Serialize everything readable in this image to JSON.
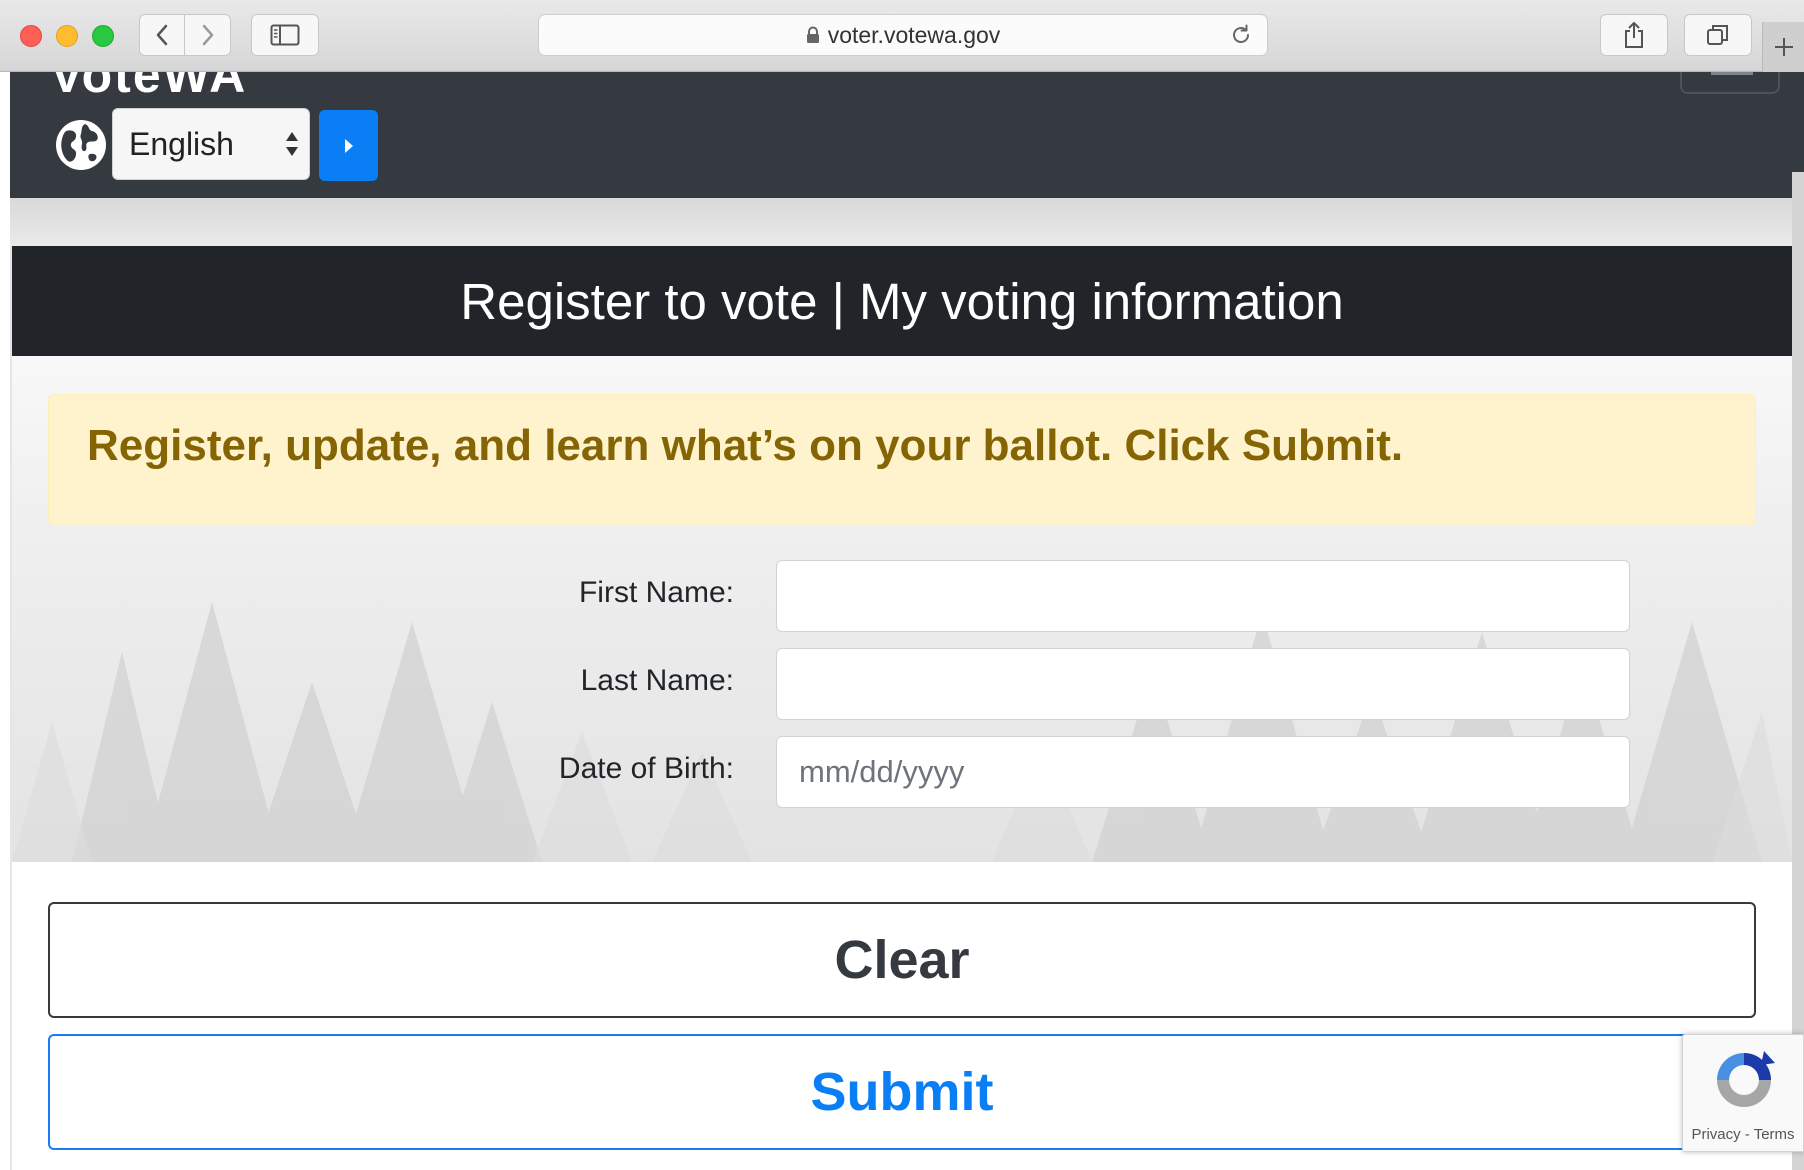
{
  "browser": {
    "url": "voter.votewa.gov"
  },
  "header": {
    "logo_text": "VoteWA",
    "language": {
      "selected": "English"
    }
  },
  "card": {
    "title": "Register to vote | My voting information",
    "alert": "Register, update, and learn what’s on your ballot. Click Submit."
  },
  "form": {
    "first_name_label": "First Name:",
    "first_name_value": "",
    "last_name_label": "Last Name:",
    "last_name_value": "",
    "dob_label": "Date of Birth:",
    "dob_placeholder": "mm/dd/yyyy",
    "dob_value": ""
  },
  "buttons": {
    "clear": "Clear",
    "submit": "Submit"
  },
  "recaptcha": {
    "privacy": "Privacy",
    "separator": "-",
    "terms": "Terms"
  },
  "colors": {
    "header_bg": "#343a40",
    "card_header_bg": "#212529",
    "alert_bg": "#fff3cd",
    "alert_text": "#856404",
    "primary_blue": "#0a7ff5"
  }
}
